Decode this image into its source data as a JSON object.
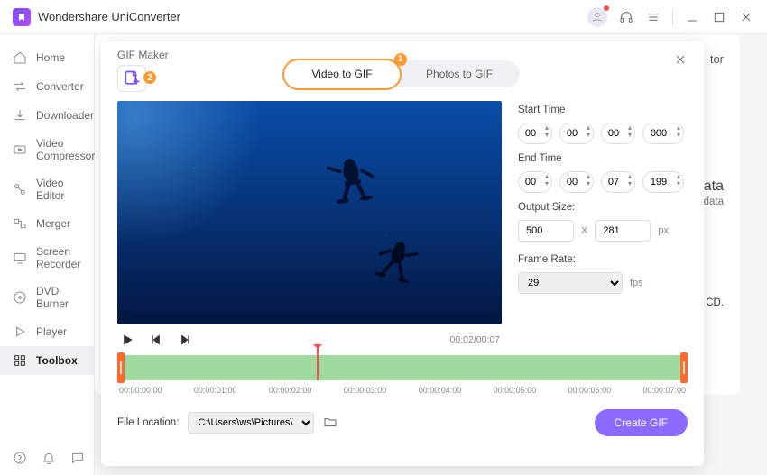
{
  "titlebar": {
    "app_name": "Wondershare UniConverter"
  },
  "sidebar": {
    "items": [
      {
        "label": "Home"
      },
      {
        "label": "Converter"
      },
      {
        "label": "Downloader"
      },
      {
        "label": "Video Compressor"
      },
      {
        "label": "Video Editor"
      },
      {
        "label": "Merger"
      },
      {
        "label": "Screen Recorder"
      },
      {
        "label": "DVD Burner"
      },
      {
        "label": "Player"
      },
      {
        "label": "Toolbox"
      }
    ]
  },
  "background": {
    "peek1": "tor",
    "peek2": "data",
    "peek3": "etadata",
    "peek4": "CD."
  },
  "modal": {
    "title": "GIF Maker",
    "badge1": "1",
    "badge2": "2",
    "tabs": {
      "video": "Video to GIF",
      "photos": "Photos to GIF"
    },
    "settings": {
      "start_label": "Start Time",
      "end_label": "End Time",
      "start": {
        "h": "00",
        "m": "00",
        "s": "00",
        "ms": "000"
      },
      "end": {
        "h": "00",
        "m": "00",
        "s": "07",
        "ms": "199"
      },
      "output_size_label": "Output Size:",
      "width": "500",
      "x": "X",
      "height": "281",
      "px": "px",
      "frame_rate_label": "Frame Rate:",
      "fps_value": "29",
      "fps_unit": "fps"
    },
    "player": {
      "time": "00:02/00:07"
    },
    "timeline": {
      "ticks": [
        "00:00:00:00",
        "00:00:01:00",
        "00:00:02:00",
        "00:00:03:00",
        "00:00:04:00",
        "00:00:05:00",
        "00:00:06:00",
        "00:00:07:00"
      ],
      "playhead_percent": 35
    },
    "bottom": {
      "file_location_label": "File Location:",
      "path": "C:\\Users\\ws\\Pictures\\Wonders",
      "create_label": "Create GIF"
    }
  }
}
